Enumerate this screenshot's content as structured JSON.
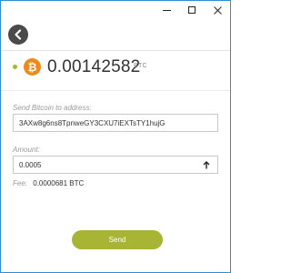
{
  "window": {
    "controls": {
      "minimize": "minimize-icon",
      "maximize": "maximize-icon",
      "close": "close-icon"
    }
  },
  "header": {
    "back_icon": "chevron-left-icon"
  },
  "balance": {
    "status_color": "#a6b82b",
    "currency_icon": "bitcoin-icon",
    "currency_symbol": "₿",
    "amount": "0.00142582",
    "unit": "BTC"
  },
  "form": {
    "address_label": "Send Bitcoin to address:",
    "address_value": "3AXw8g6ns8TpnweGY3CXU7iEXTsTY1hujG",
    "amount_label": "Amount:",
    "amount_value": "0.0005",
    "amount_icon": "arrow-up-icon",
    "fee_label": "Fee:",
    "fee_value": "0.0000681 BTC"
  },
  "send_button": {
    "label": "Send",
    "color": "#a8b534"
  },
  "colors": {
    "accent": "#a8b534",
    "bitcoin": "#f0891c",
    "window_border": "#2b8ed6"
  }
}
